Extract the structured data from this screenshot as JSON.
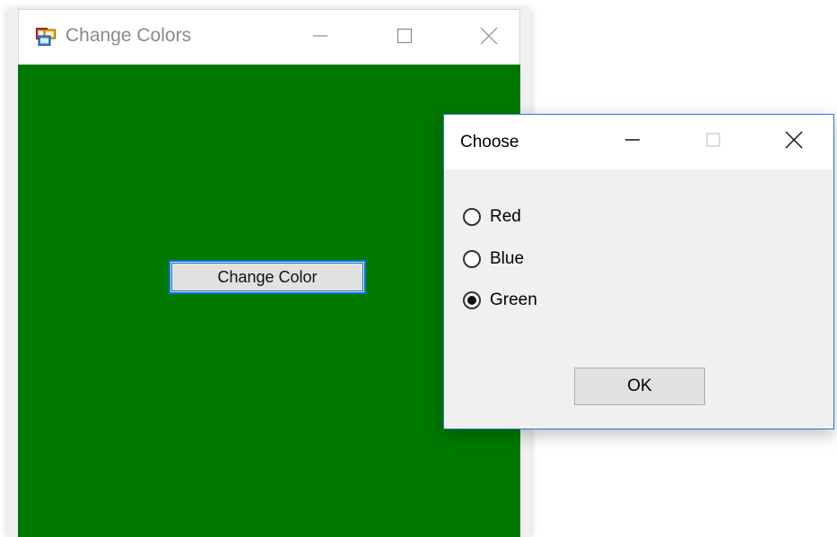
{
  "main_window": {
    "title": "Change Colors",
    "icon": "app-window-icon",
    "background_color": "#007800",
    "change_color_button": "Change Color",
    "controls": {
      "minimize": "minimize-icon",
      "maximize": "maximize-icon",
      "close": "close-icon"
    }
  },
  "dialog": {
    "title": "Choose",
    "options": [
      {
        "label": "Red",
        "checked": false
      },
      {
        "label": "Blue",
        "checked": false
      },
      {
        "label": "Green",
        "checked": true
      }
    ],
    "ok_label": "OK",
    "controls": {
      "minimize": "minimize-icon",
      "maximize": "maximize-icon",
      "close": "close-icon"
    }
  }
}
